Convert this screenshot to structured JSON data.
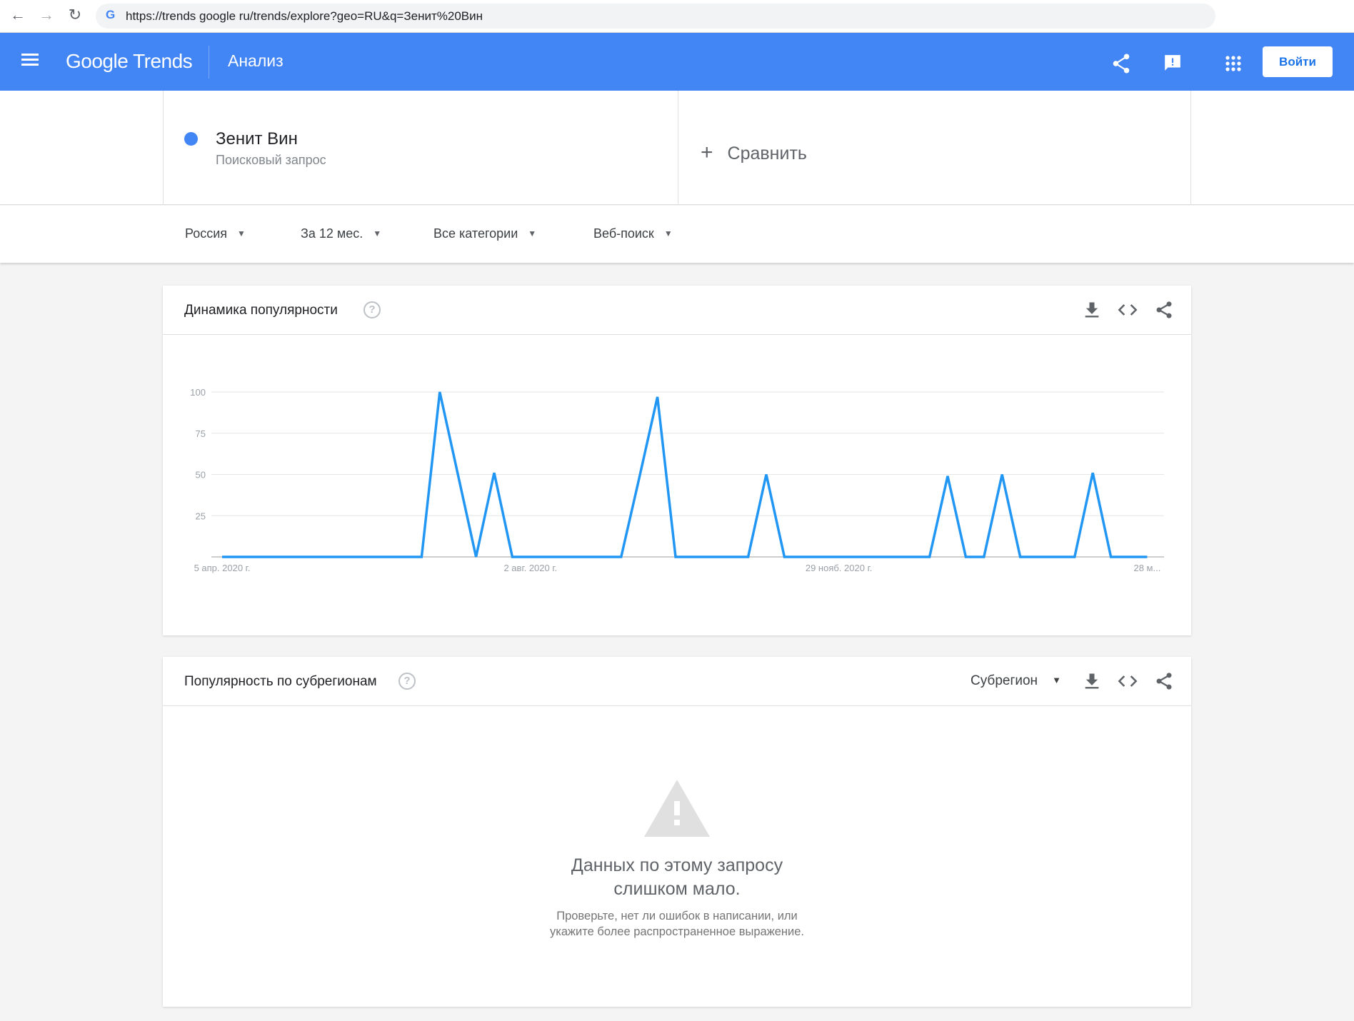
{
  "browser": {
    "url": "https://trends google ru/trends/explore?geo=RU&q=Зенит%20Вин",
    "back": "←",
    "forward": "→",
    "reload": "↻",
    "g": "G"
  },
  "header": {
    "logo": "Google Trends",
    "title": "Анализ",
    "login": "Войти",
    "color": "#4285f4"
  },
  "query": {
    "term": "Зенит Вин",
    "type": "Поисковый запрос",
    "compare": "Сравнить",
    "plus": "+",
    "color": "#4285f4"
  },
  "filters": [
    {
      "label": "Россия"
    },
    {
      "label": "За 12 мес."
    },
    {
      "label": "Все категории"
    },
    {
      "label": "Веб-поиск"
    }
  ],
  "interest_card": {
    "title": "Динамика популярности",
    "help": "?"
  },
  "region_card": {
    "title": "Популярность по субрегионам",
    "help": "?",
    "dropdown": "Субрегион",
    "empty_title_1": "Данных по этому запросу",
    "empty_title_2": "слишком мало.",
    "empty_sub_1": "Проверьте, нет ли ошибок в написании, или",
    "empty_sub_2": "укажите более распространенное выражение."
  },
  "chart_data": {
    "type": "line",
    "title": "Динамика популярности",
    "ylim": [
      0,
      100
    ],
    "yticks": [
      25,
      50,
      75,
      100
    ],
    "xtick_labels": [
      {
        "index": 0,
        "label": "5 апр. 2020 г."
      },
      {
        "index": 17,
        "label": "2 авг. 2020 г."
      },
      {
        "index": 34,
        "label": "29 нояб. 2020 г."
      },
      {
        "index": 51,
        "label": "28 м..."
      }
    ],
    "series": [
      {
        "name": "Зенит Вин",
        "color": "#2196f3",
        "values": [
          0,
          0,
          0,
          0,
          0,
          0,
          0,
          0,
          0,
          0,
          0,
          0,
          100,
          50,
          0,
          51,
          0,
          0,
          0,
          0,
          0,
          0,
          0,
          48,
          97,
          0,
          0,
          0,
          0,
          0,
          50,
          0,
          0,
          0,
          0,
          0,
          0,
          0,
          0,
          0,
          49,
          0,
          0,
          50,
          0,
          0,
          0,
          0,
          51,
          0,
          0,
          0
        ]
      }
    ],
    "grid": true
  }
}
